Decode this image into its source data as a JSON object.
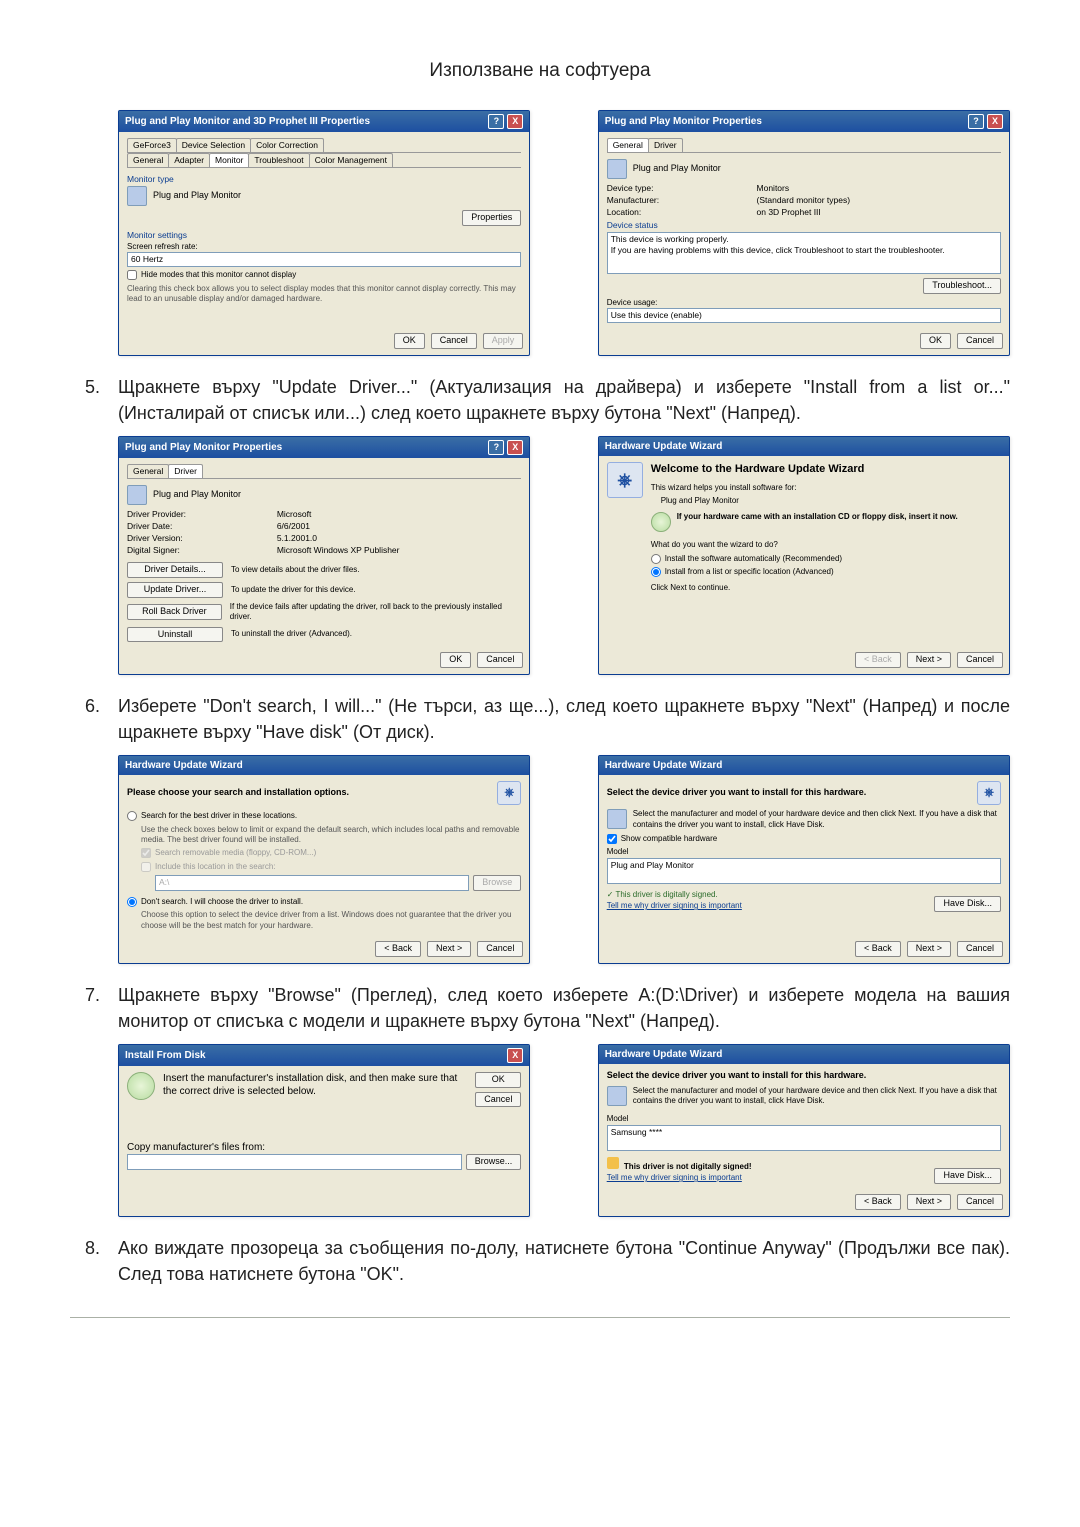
{
  "page_title": "Използване на софтуера",
  "s1": {
    "d1": {
      "title": "Plug and Play Monitor and 3D Prophet III Properties",
      "tabs_top": [
        "GeForce3",
        "Device Selection",
        "Color Correction"
      ],
      "tabs_bot": [
        "General",
        "Adapter",
        "Monitor",
        "Troubleshoot",
        "Color Management"
      ],
      "grp_monitor_type": "Monitor type",
      "monitor_type": "Plug and Play Monitor",
      "btn_properties": "Properties",
      "grp_monitor_settings": "Monitor settings",
      "refresh_label": "Screen refresh rate:",
      "refresh_value": "60 Hertz",
      "hide_label": "Hide modes that this monitor cannot display",
      "hide_desc": "Clearing this check box allows you to select display modes that this monitor cannot display correctly. This may lead to an unusable display and/or damaged hardware.",
      "ok": "OK",
      "cancel": "Cancel",
      "apply": "Apply"
    },
    "d2": {
      "title": "Plug and Play Monitor Properties",
      "tabs": [
        "General",
        "Driver"
      ],
      "name": "Plug and Play Monitor",
      "k_type": "Device type:",
      "v_type": "Monitors",
      "k_manu": "Manufacturer:",
      "v_manu": "(Standard monitor types)",
      "k_loc": "Location:",
      "v_loc": "on 3D Prophet III",
      "grp_status": "Device status",
      "status_ok": "This device is working properly.",
      "status_help": "If you are having problems with this device, click Troubleshoot to start the troubleshooter.",
      "btn_trouble": "Troubleshoot...",
      "usage_label": "Device usage:",
      "usage_value": "Use this device (enable)",
      "ok": "OK",
      "cancel": "Cancel"
    }
  },
  "step5": "Щракнете върху \"Update Driver...\" (Актуализация на драйвера) и изберете \"Install from a list or...\" (Инсталирай от списък или...) след което щракнете върху бутона \"Next\" (Напред).",
  "s2": {
    "d1": {
      "title": "Plug and Play Monitor Properties",
      "tabs": [
        "General",
        "Driver"
      ],
      "name": "Plug and Play Monitor",
      "k_prov": "Driver Provider:",
      "v_prov": "Microsoft",
      "k_date": "Driver Date:",
      "v_date": "6/6/2001",
      "k_ver": "Driver Version:",
      "v_ver": "5.1.2001.0",
      "k_sign": "Digital Signer:",
      "v_sign": "Microsoft Windows XP Publisher",
      "btn_details": "Driver Details...",
      "desc_details": "To view details about the driver files.",
      "btn_update": "Update Driver...",
      "desc_update": "To update the driver for this device.",
      "btn_roll": "Roll Back Driver",
      "desc_roll": "If the device fails after updating the driver, roll back to the previously installed driver.",
      "btn_un": "Uninstall",
      "desc_un": "To uninstall the driver (Advanced).",
      "ok": "OK",
      "cancel": "Cancel"
    },
    "d2": {
      "title": "Hardware Update Wizard",
      "welcome": "Welcome to the Hardware Update Wizard",
      "helps": "This wizard helps you install software for:",
      "dev": "Plug and Play Monitor",
      "cd": "If your hardware came with an installation CD or floppy disk, insert it now.",
      "ask": "What do you want the wizard to do?",
      "opt1": "Install the software automatically (Recommended)",
      "opt2": "Install from a list or specific location (Advanced)",
      "cont": "Click Next to continue.",
      "back": "< Back",
      "next": "Next >",
      "cancel": "Cancel"
    }
  },
  "step6": "Изберете \"Don't search, I will...\" (Не търси, аз ще...), след което щракнете върху \"Next\" (Напред) и после щракнете върху \"Have disk\" (От диск).",
  "s3": {
    "d1": {
      "title": "Hardware Update Wizard",
      "head": "Please choose your search and installation options.",
      "opt_search": "Search for the best driver in these locations.",
      "search_desc": "Use the check boxes below to limit or expand the default search, which includes local paths and removable media. The best driver found will be installed.",
      "chk_rem": "Search removable media (floppy, CD-ROM...)",
      "chk_inc": "Include this location in the search:",
      "path": "A:\\",
      "browse": "Browse",
      "opt_dont": "Don't search. I will choose the driver to install.",
      "dont_desc": "Choose this option to select the device driver from a list. Windows does not guarantee that the driver you choose will be the best match for your hardware.",
      "back": "< Back",
      "next": "Next >",
      "cancel": "Cancel"
    },
    "d2": {
      "title": "Hardware Update Wizard",
      "head": "Select the device driver you want to install for this hardware.",
      "instr": "Select the manufacturer and model of your hardware device and then click Next. If you have a disk that contains the driver you want to install, click Have Disk.",
      "chk_compat": "Show compatible hardware",
      "model_lbl": "Model",
      "model_val": "Plug and Play Monitor",
      "signed": "This driver is digitally signed.",
      "why": "Tell me why driver signing is important",
      "have": "Have Disk...",
      "back": "< Back",
      "next": "Next >",
      "cancel": "Cancel"
    }
  },
  "step7": "Щракнете върху \"Browse\" (Преглед), след което изберете A:(D:\\Driver) и изберете модела на вашия монитор от списъка с модели и щракнете върху бутона \"Next\" (Напред).",
  "s4": {
    "d1": {
      "title": "Install From Disk",
      "msg": "Insert the manufacturer's installation disk, and then make sure that the correct drive is selected below.",
      "ok": "OK",
      "cancel": "Cancel",
      "copy_lbl": "Copy manufacturer's files from:",
      "browse": "Browse..."
    },
    "d2": {
      "title": "Hardware Update Wizard",
      "head": "Select the device driver you want to install for this hardware.",
      "instr": "Select the manufacturer and model of your hardware device and then click Next. If you have a disk that contains the driver you want to install, click Have Disk.",
      "model_lbl": "Model",
      "model_val": "Samsung ****",
      "notsigned": "This driver is not digitally signed!",
      "why": "Tell me why driver signing is important",
      "have": "Have Disk...",
      "back": "< Back",
      "next": "Next >",
      "cancel": "Cancel"
    }
  },
  "step8": "Ако виждате прозореца за съобщения по-долу, натиснете бутона \"Continue Anyway\" (Продължи все пак). След това натиснете бутона \"OK\".",
  "nums": {
    "n5": "5.",
    "n6": "6.",
    "n7": "7.",
    "n8": "8."
  },
  "glyphs": {
    "help": "?",
    "close": "X",
    "check": "✓"
  }
}
